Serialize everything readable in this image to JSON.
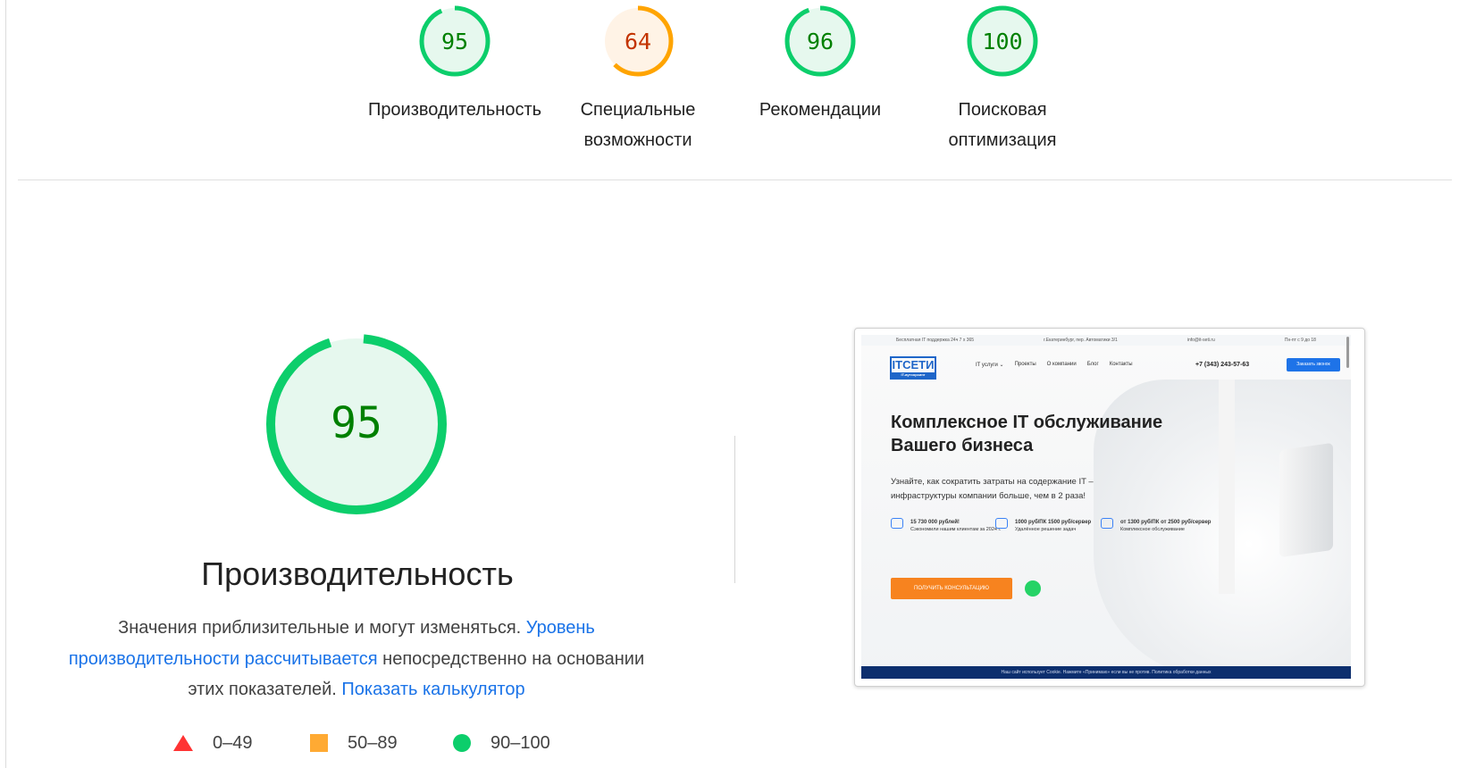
{
  "scores": [
    {
      "value": "95",
      "label_lines": [
        "Производительность"
      ],
      "fraction": 0.95,
      "color": "#0cce6b",
      "text_color": "#008000",
      "bg": "#e6f8ee"
    },
    {
      "value": "64",
      "label_lines": [
        "Специальные",
        "возможности"
      ],
      "fraction": 0.64,
      "color": "#ffa400",
      "text_color": "#c33300",
      "bg": "#fff3e6"
    },
    {
      "value": "96",
      "label_lines": [
        "Рекомендации"
      ],
      "fraction": 0.96,
      "color": "#0cce6b",
      "text_color": "#008000",
      "bg": "#e6f8ee"
    },
    {
      "value": "100",
      "label_lines": [
        "Поисковая",
        "оптимизация"
      ],
      "fraction": 1.0,
      "color": "#0cce6b",
      "text_color": "#008000",
      "bg": "#e6f8ee"
    }
  ],
  "performance": {
    "value": "95",
    "fraction": 0.95,
    "title": "Производительность",
    "desc_pre": "Значения приблизительные и могут изменяться. ",
    "desc_link1": "Уровень производительности рассчитывается",
    "desc_mid": " непосредственно на основании этих показателей. ",
    "desc_link2": "Показать калькулятор"
  },
  "legend": [
    {
      "shape": "triangle",
      "range": "0–49",
      "color": "#ff3333"
    },
    {
      "shape": "square",
      "range": "50–89",
      "color": "#ffaa33"
    },
    {
      "shape": "circle",
      "range": "90–100",
      "color": "#0cce6b"
    }
  ],
  "screenshot": {
    "topbar": [
      "Бесплатная IT поддержка 24ч 7 х 365",
      "г.Екатеринбург, пер. Автоматики 3/1",
      "info@it-seti.ru",
      "Пн-пт с 9 до 18"
    ],
    "logo": "ITСЕТИ",
    "logo_sub": "IT-аутсорсинг",
    "menu": [
      "IT услуги ⌄",
      "Проекты",
      "О компании",
      "Блог",
      "Контакты"
    ],
    "phone": "+7 (343) 243-57-63",
    "cta": "Заказать звонок",
    "headline": "Комплексное IT обслуживание Вашего бизнеса",
    "subtext": "Узнайте, как сократить затраты на содержание IT – инфраструктуры компании больше, чем в 2 раза!",
    "features": [
      {
        "title": "15 730 000 рублей!",
        "text": "Сэкономили нашим клиентам за 2024 г."
      },
      {
        "title": "1000 руб/ПК 1500 руб/сервер",
        "text": "Удалённое решение задач"
      },
      {
        "title": "от 1300 руб/ПК от 2500 руб/сервер",
        "text": "Комплексное обслуживание"
      }
    ],
    "button": "ПОЛУЧИТЬ КОНСУЛЬТАЦИЮ",
    "footer": "Наш сайт использует Cookie. Нажмите «Принимаю» если вы не против. Политика обработки данных"
  }
}
